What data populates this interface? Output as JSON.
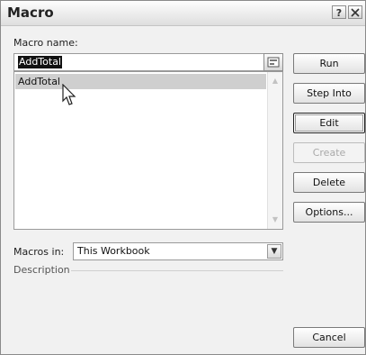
{
  "window": {
    "title": "Macro",
    "help_icon": "question-mark-icon",
    "close_icon": "close-icon"
  },
  "macro_name": {
    "label": "Macro name:",
    "value": "AddTotal",
    "browse_icon": "browse-icon"
  },
  "macro_list": {
    "items": [
      {
        "label": "AddTotal",
        "selected": true
      }
    ]
  },
  "buttons": {
    "run": "Run",
    "step_into": "Step Into",
    "edit": "Edit",
    "create": "Create",
    "delete": "Delete",
    "options": "Options...",
    "cancel": "Cancel"
  },
  "macros_in": {
    "label": "Macros in:",
    "value": "This Workbook"
  },
  "description": {
    "label": "Description",
    "text": ""
  },
  "colors": {
    "selection": "#111111",
    "list_highlight": "#cfcfcf",
    "dialog_bg": "#f1f1f1"
  }
}
